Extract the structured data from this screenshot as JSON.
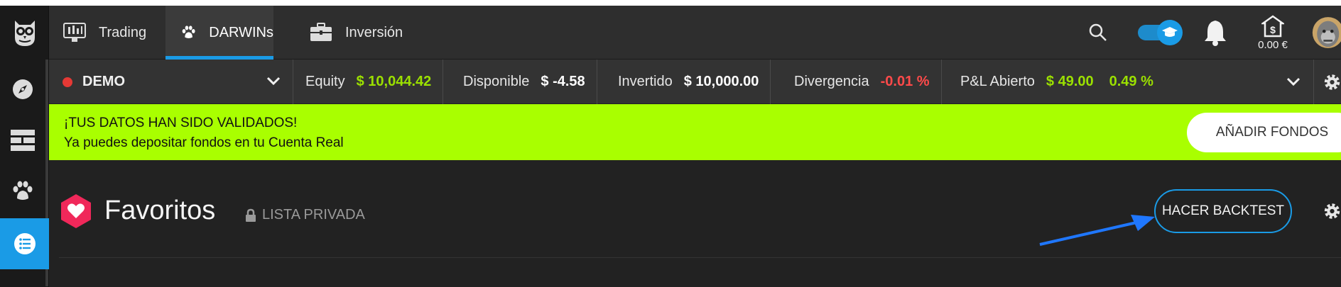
{
  "colors": {
    "accent": "#1a9be6",
    "positive": "#9be000",
    "negative": "#ff4a4a",
    "banner": "#a9ff00",
    "heart": "#f0285a"
  },
  "sidebar": {
    "logo": "owl-logo-icon",
    "items": [
      {
        "icon": "compass-icon"
      },
      {
        "icon": "grid-icon"
      },
      {
        "icon": "paw-icon"
      },
      {
        "icon": "list-icon",
        "active": true
      }
    ]
  },
  "topnav": {
    "tabs": [
      {
        "label": "Trading",
        "icon": "chart-icon"
      },
      {
        "label": "DARWINs",
        "icon": "paw-icon",
        "active": true
      },
      {
        "label": "Inversión",
        "icon": "briefcase-icon"
      }
    ],
    "balance": "0.00 €"
  },
  "account": {
    "label": "DEMO",
    "stats": [
      {
        "key": "Equity",
        "value": "$ 10,044.42"
      },
      {
        "key": "Disponible",
        "value": "$ -4.58"
      },
      {
        "key": "Invertido",
        "value": "$ 10,000.00"
      },
      {
        "key": "Divergencia",
        "value": "-0.01 %"
      },
      {
        "key": "P&L Abierto",
        "value": "$ 49.00",
        "value2": "0.49 %"
      }
    ]
  },
  "banner": {
    "line1": "¡TUS DATOS HAN SIDO VALIDADOS!",
    "line2": "Ya puedes depositar fondos en tu Cuenta Real",
    "button": "AÑADIR FONDOS"
  },
  "main": {
    "title": "Favoritos",
    "privacy": "LISTA PRIVADA",
    "backtest_button": "HACER BACKTEST"
  }
}
